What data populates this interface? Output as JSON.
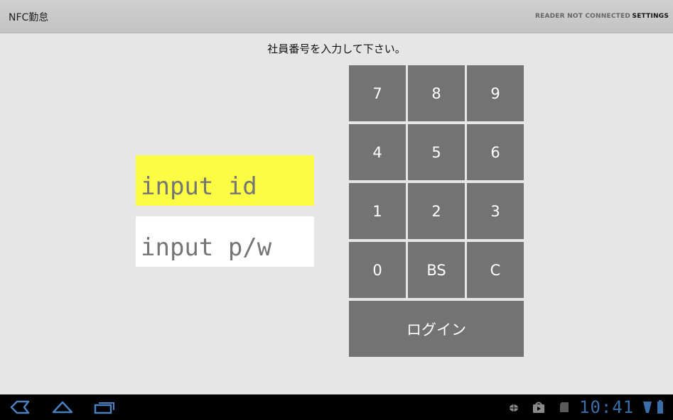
{
  "action_bar": {
    "title": "NFC勤怠",
    "status": "READER NOT CONNECTED",
    "settings": "SETTINGS"
  },
  "main": {
    "instruction": "社員番号を入力して下さい。",
    "id_field": {
      "value": "",
      "placeholder": "input id"
    },
    "pw_field": {
      "value": "",
      "placeholder": "input p/w"
    }
  },
  "keypad": {
    "keys": [
      "7",
      "8",
      "9",
      "4",
      "5",
      "6",
      "1",
      "2",
      "3",
      "0",
      "BS",
      "C"
    ],
    "login": "ログイン"
  },
  "system_bar": {
    "time": "10:41",
    "icons": [
      "back-icon",
      "home-icon",
      "recent-apps-icon",
      "usb-debug-icon",
      "store-notification-icon",
      "sd-card-icon",
      "wifi-icon",
      "battery-icon"
    ],
    "accent_color": "#3a6ea8"
  },
  "colors": {
    "id_field_bg": "#fcfc44",
    "key_bg": "#737373"
  }
}
